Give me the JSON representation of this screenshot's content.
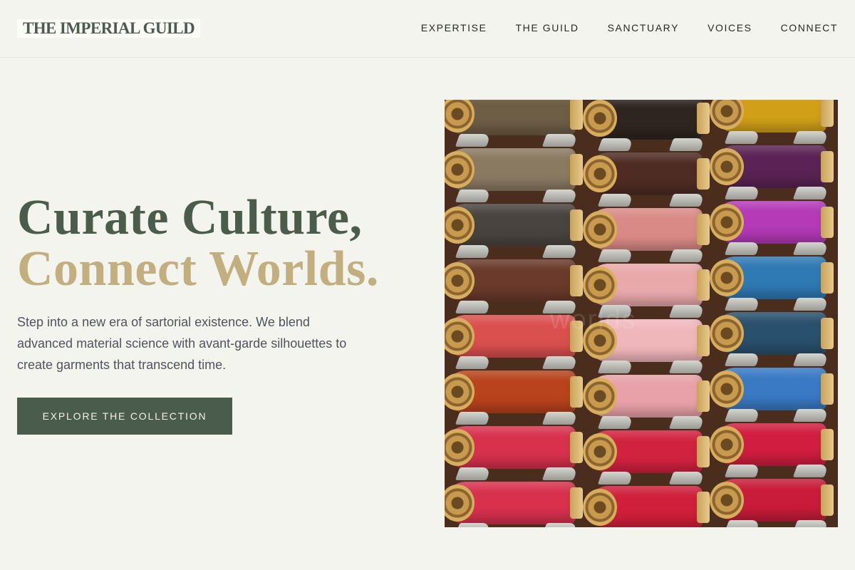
{
  "brand": {
    "logo_text": "THE IMPERIAL GUILD"
  },
  "nav": {
    "items": [
      {
        "label": "EXPERTISE"
      },
      {
        "label": "THE GUILD"
      },
      {
        "label": "SANCTUARY"
      },
      {
        "label": "VOICES"
      },
      {
        "label": "CONNECT"
      }
    ]
  },
  "hero": {
    "headline_line1": "Curate Culture,",
    "headline_line2": "Connect Worlds.",
    "lead": "Step into a new era of sartorial existence. We blend advanced material science with avant-garde silhouettes to create garments that transcend time.",
    "cta_label": "EXPLORE THE COLLECTION",
    "image_alt": "Rows of colorful thread spools on a rack",
    "image_watermark": "worlds"
  },
  "colors": {
    "accent_green": "#4a5d4c",
    "accent_gold": "#c2ae7f",
    "background": "#f4f4ef",
    "thread_columns": [
      [
        "#6e5e46",
        "#8a7a62",
        "#4a4440",
        "#6a3a2a",
        "#d9504e",
        "#b8431d",
        "#d7314e",
        "#d7314e"
      ],
      [
        "#2f2520",
        "#4e2c24",
        "#d98a86",
        "#e9a8aa",
        "#f0b7bb",
        "#e8a1a8",
        "#d1223f",
        "#cf1f3a"
      ],
      [
        "#d2a018",
        "#5b2355",
        "#b43ab8",
        "#2f79b4",
        "#29506d",
        "#3a7ac4",
        "#d11e40",
        "#c91c3a"
      ]
    ]
  }
}
